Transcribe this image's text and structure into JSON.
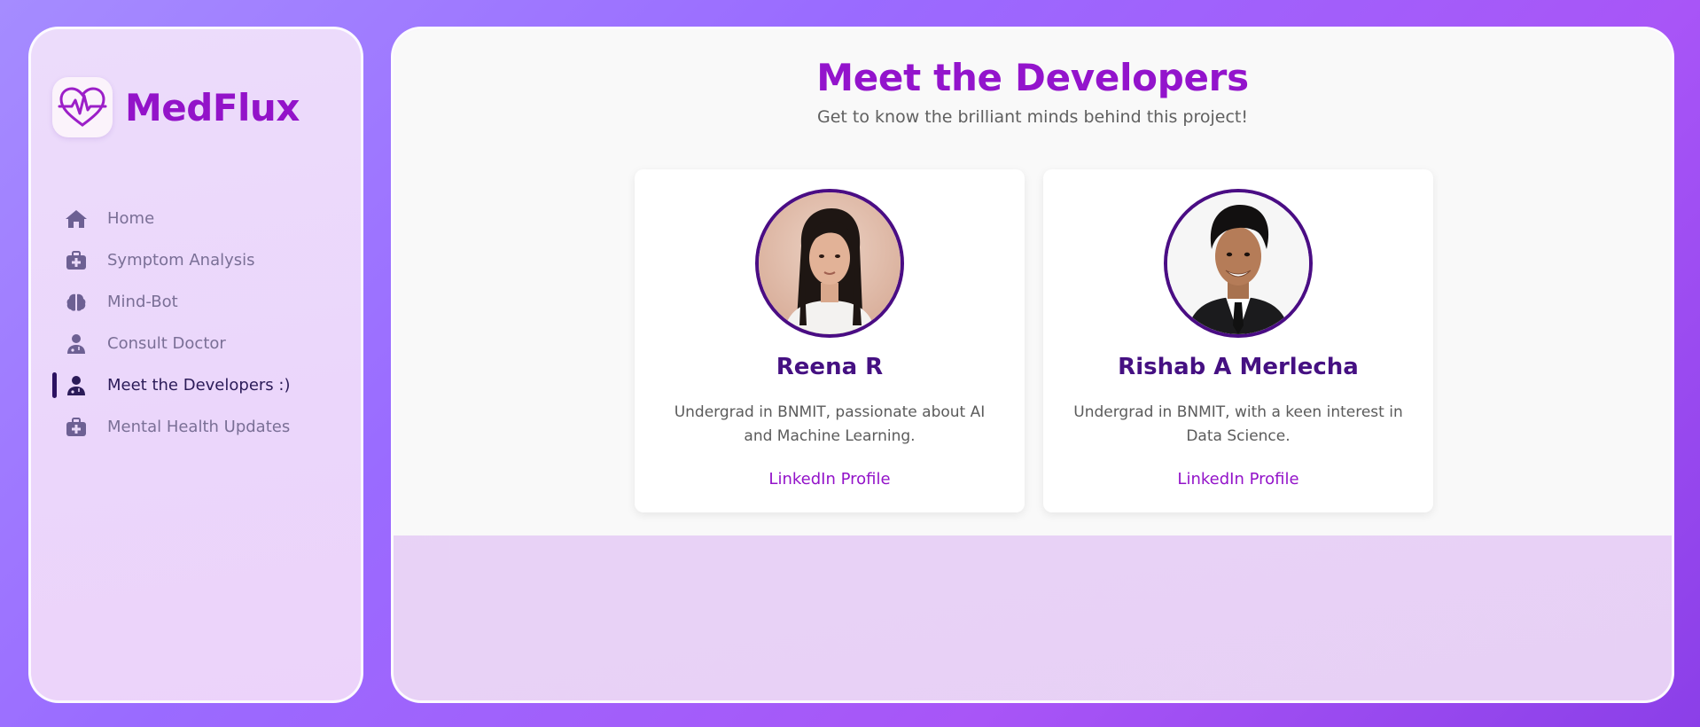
{
  "sidebar": {
    "brand": "MedFlux",
    "items": [
      {
        "label": "Home",
        "icon": "home-icon",
        "active": false
      },
      {
        "label": "Symptom Analysis",
        "icon": "medkit-icon",
        "active": false
      },
      {
        "label": "Mind-Bot",
        "icon": "brain-icon",
        "active": false
      },
      {
        "label": "Consult Doctor",
        "icon": "doctor-icon",
        "active": false
      },
      {
        "label": "Meet the Developers :)",
        "icon": "doctor-icon",
        "active": true
      },
      {
        "label": "Mental Health Updates",
        "icon": "medkit-icon",
        "active": false
      }
    ]
  },
  "main": {
    "title": "Meet the Developers",
    "subtitle": "Get to know the brilliant minds behind this project!",
    "developers": [
      {
        "name": "Reena R",
        "description": "Undergrad in BNMIT, passionate about AI and Machine Learning.",
        "link_label": "LinkedIn Profile"
      },
      {
        "name": "Rishab A Merlecha",
        "description": "Undergrad in BNMIT, with a keen interest in Data Science.",
        "link_label": "LinkedIn Profile"
      }
    ]
  },
  "colors": {
    "accent": "#9313c9",
    "nav_text": "#7a6f96",
    "active_text": "#2b1b58",
    "card_name": "#451082"
  }
}
